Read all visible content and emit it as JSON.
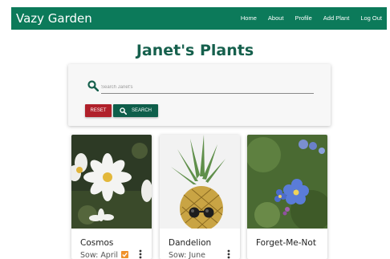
{
  "navbar": {
    "brand": "Vazy Garden",
    "links": [
      "Home",
      "About",
      "Profile",
      "Add Plant",
      "Log Out"
    ],
    "color": "#0c7a5a"
  },
  "page": {
    "title": "Janet's Plants"
  },
  "search": {
    "placeholder": "Search Janet's",
    "reset_label": "RESET",
    "search_label": "SEARCH",
    "icon": "search-icon"
  },
  "plants": [
    {
      "name": "Cosmos",
      "sow": "Sow: April",
      "checked": true
    },
    {
      "name": "Dandelion",
      "sow": "Sow: June",
      "checked": false
    },
    {
      "name": "Forget-Me-Not",
      "sow": "",
      "checked": false
    }
  ],
  "colors": {
    "accent": "#16604d",
    "reset": "#b0202a",
    "search": "#0e5e4a",
    "check": "#f0922a"
  }
}
